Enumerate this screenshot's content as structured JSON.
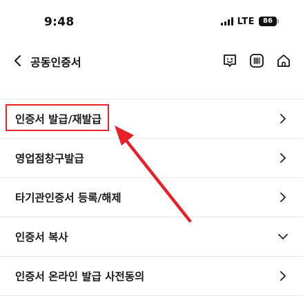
{
  "status_bar": {
    "time": "9:48",
    "network": "LTE",
    "battery": "86",
    "icons": [
      "signal-icon",
      "battery-icon"
    ]
  },
  "header": {
    "back_icon": "chevron-left-icon",
    "title": "공동인증서",
    "actions": [
      {
        "name": "chat-bot-icon"
      },
      {
        "name": "barcode-icon"
      },
      {
        "name": "home-icon"
      }
    ]
  },
  "menu": {
    "items": [
      {
        "label": "인증서 발급/재발급",
        "indicator": "chevron-right-icon"
      },
      {
        "label": "영업점창구발급",
        "indicator": "chevron-right-icon"
      },
      {
        "label": "타기관인증서 등록/해제",
        "indicator": "chevron-right-icon"
      },
      {
        "label": "인증서 복사",
        "indicator": "chevron-down-icon"
      },
      {
        "label": "인증서 온라인 발급 사전동의",
        "indicator": "chevron-right-icon"
      }
    ]
  },
  "annotation": {
    "highlight_color": "#e8202a",
    "target": "인증서 발급/재발급"
  }
}
